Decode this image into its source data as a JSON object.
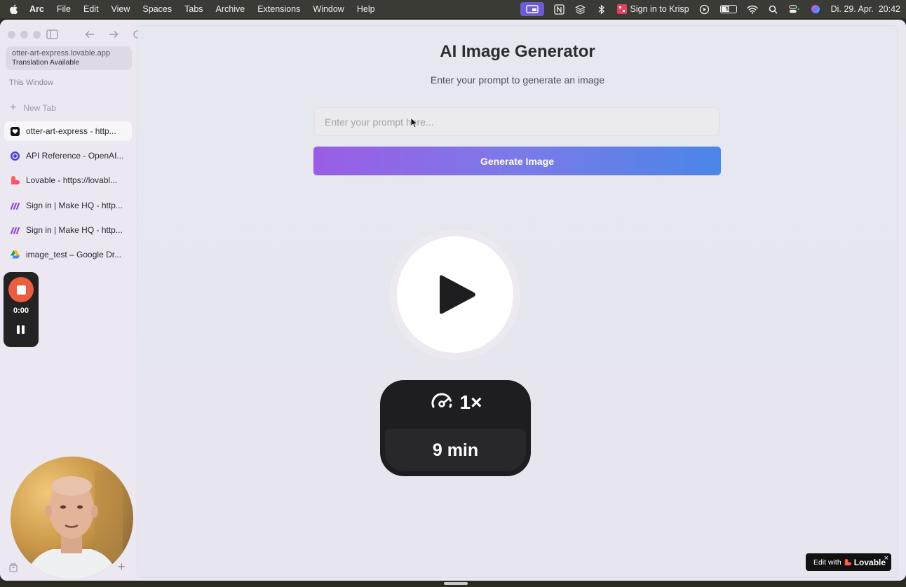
{
  "menubar": {
    "app_name": "Arc",
    "items": [
      "File",
      "Edit",
      "View",
      "Spaces",
      "Tabs",
      "Archive",
      "Extensions",
      "Window",
      "Help"
    ],
    "krisp_label": "Sign in to Krisp",
    "battery_level": "52",
    "datetime": "Di. 29. Apr.  20:42"
  },
  "sidebar": {
    "url": "otter-art-express.lovable.app",
    "translation": "Translation Available",
    "section_label": "This Window",
    "new_tab_label": "New Tab",
    "tabs": [
      {
        "label": "otter-art-express - http...",
        "icon": "lovable-heart-icon",
        "active": true
      },
      {
        "label": "API Reference - OpenAI...",
        "icon": "openai-icon"
      },
      {
        "label": "Lovable - https://lovabl...",
        "icon": "lovable-icon"
      },
      {
        "label": "Sign in | Make HQ - http...",
        "icon": "make-icon"
      },
      {
        "label": "Sign in | Make HQ - http...",
        "icon": "make-icon"
      },
      {
        "label": "image_test – Google Dr...",
        "icon": "google-drive-icon"
      }
    ]
  },
  "recorder": {
    "time": "0:00"
  },
  "page": {
    "title": "AI Image Generator",
    "subtitle": "Enter your prompt to generate an image",
    "prompt_placeholder": "Enter your prompt here...",
    "generate_label": "Generate Image"
  },
  "video_overlay": {
    "speed": "1×",
    "duration": "9 min"
  },
  "badge": {
    "edit_with": "Edit with",
    "brand": "Lovable",
    "close": "×"
  },
  "colors": {
    "accent_purple": "#9b5de5",
    "accent_blue": "#4a86e8",
    "record_red": "#ec5c3e",
    "menubar_bg": "#3a3b35"
  }
}
